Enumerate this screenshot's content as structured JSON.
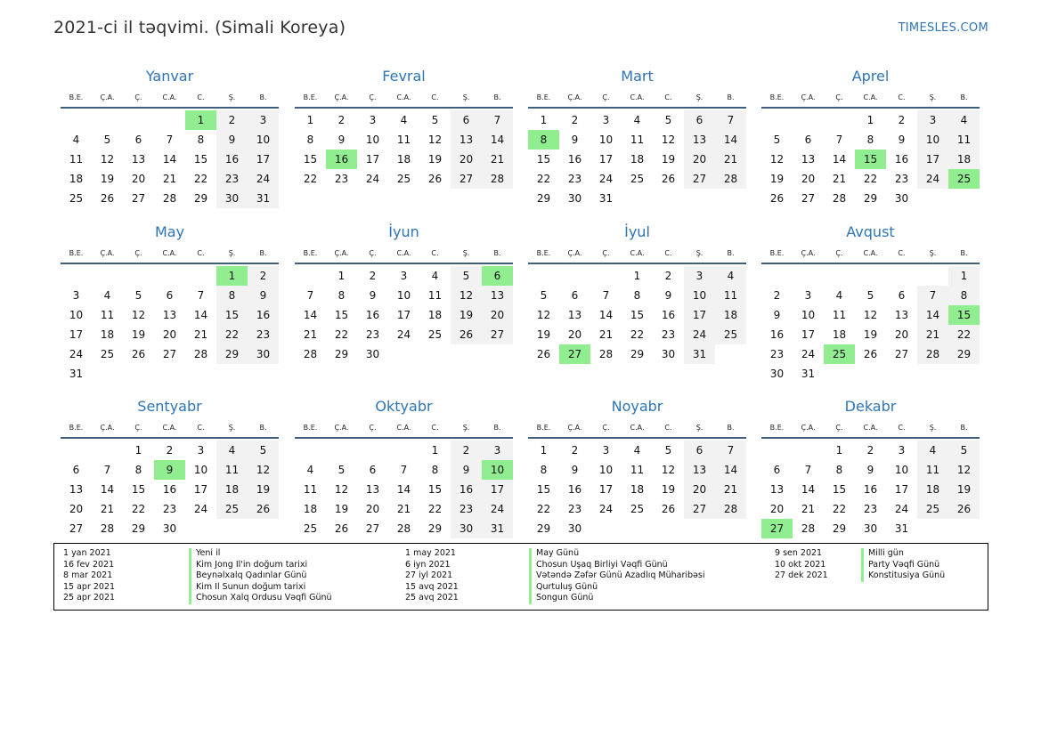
{
  "header": {
    "title": "2021-ci il təqvimi. (Simali Koreya)",
    "brand": "TIMESLES.COM"
  },
  "weekdays": [
    "B.E.",
    "Ç.A.",
    "Ç.",
    "C.A.",
    "C.",
    "Ş.",
    "B."
  ],
  "colors": {
    "accent": "#2e75b6",
    "holiday": "#90ee90",
    "weekend": "#f2f2f2",
    "rule": "#3f5f7f"
  },
  "months": [
    {
      "name": "Yanvar",
      "offset": 4,
      "days": 31,
      "holidays": [
        1
      ]
    },
    {
      "name": "Fevral",
      "offset": 0,
      "days": 28,
      "holidays": [
        16
      ]
    },
    {
      "name": "Mart",
      "offset": 0,
      "days": 31,
      "holidays": [
        8
      ]
    },
    {
      "name": "Aprel",
      "offset": 3,
      "days": 30,
      "holidays": [
        15,
        25
      ]
    },
    {
      "name": "May",
      "offset": 5,
      "days": 31,
      "holidays": [
        1
      ]
    },
    {
      "name": "İyun",
      "offset": 1,
      "days": 30,
      "holidays": [
        6
      ]
    },
    {
      "name": "İyul",
      "offset": 3,
      "days": 31,
      "holidays": [
        27
      ]
    },
    {
      "name": "Avqust",
      "offset": 6,
      "days": 31,
      "holidays": [
        15,
        25
      ]
    },
    {
      "name": "Sentyabr",
      "offset": 2,
      "days": 30,
      "holidays": [
        9
      ]
    },
    {
      "name": "Oktyabr",
      "offset": 4,
      "days": 31,
      "holidays": [
        10
      ]
    },
    {
      "name": "Noyabr",
      "offset": 0,
      "days": 30,
      "holidays": []
    },
    {
      "name": "Dekabr",
      "offset": 2,
      "days": 31,
      "holidays": [
        27
      ]
    }
  ],
  "legend": {
    "col1_dates": [
      "1 yan 2021",
      "16 fev 2021",
      "8 mar 2021",
      "15 apr 2021",
      "25 apr 2021"
    ],
    "col1_names": [
      "Yeni il",
      "Kim Jong Il'in doğum tarixi",
      "Beynəlxalq Qadınlar Günü",
      "Kim Il Sunun doğum tarixi",
      "Chosun Xalq Ordusu Vəqfi Günü"
    ],
    "col2_dates": [
      "1 may 2021",
      "6 iyn 2021",
      "27 iyl 2021",
      "15 avq 2021",
      "25 avq 2021"
    ],
    "col2_names": [
      "May Günü",
      "Chosun Uşaq Birliyi Vəqfi Günü",
      "Vətəndə Zəfər Günü Azadlıq Müharibəsi",
      "Qurtuluş Günü",
      "Songun Günü"
    ],
    "col3_dates": [
      "9 sen 2021",
      "10 okt 2021",
      "27 dek 2021"
    ],
    "col3_names": [
      "Milli gün",
      "Party Vəqfi Günü",
      "Konstitusiya Günü"
    ]
  }
}
